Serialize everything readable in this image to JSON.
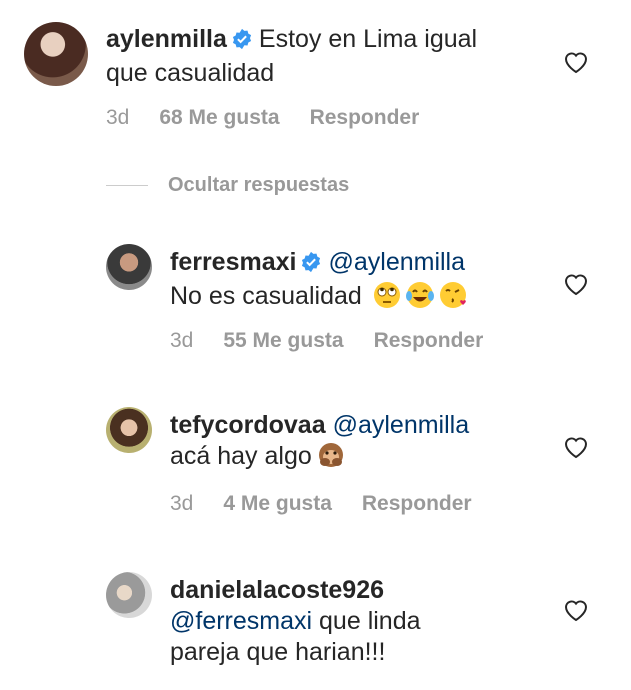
{
  "comments": [
    {
      "username": "aylenmilla",
      "text_line1": "Estoy en Lima igual",
      "text_line2": "que casualidad",
      "time": "3d",
      "likes": "68 Me gusta",
      "reply": "Responder"
    },
    {
      "username": "ferresmaxi",
      "mention": "@aylenmilla",
      "text": "No es casualidad",
      "emojis": [
        "face-rolling-eyes",
        "tears-of-joy",
        "face-blowing-kiss"
      ],
      "time": "3d",
      "likes": "55 Me gusta",
      "reply": "Responder"
    },
    {
      "username": "tefycordovaa",
      "mention": "@aylenmilla",
      "text": "acá hay algo",
      "emojis": [
        "speak-no-evil-monkey"
      ],
      "time": "3d",
      "likes": "4 Me gusta",
      "reply": "Responder"
    },
    {
      "username": "danielalacoste926",
      "mention": "@ferresmaxi",
      "text_line1": "que linda",
      "text_line2": "pareja que harian!!!"
    }
  ],
  "hide_replies": "Ocultar respuestas",
  "colors": {
    "verified": "#3897f0",
    "mention": "#003569",
    "meta": "#999999"
  }
}
